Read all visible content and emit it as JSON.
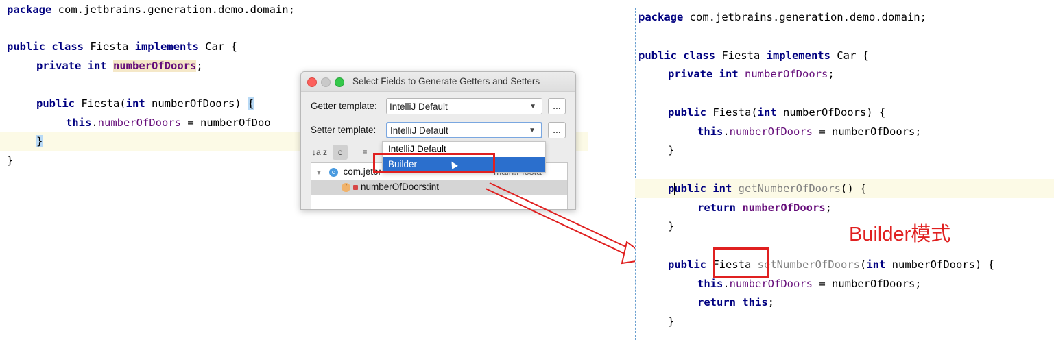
{
  "left_code": {
    "package_kw": "package",
    "package_name": " com.jetbrains.generation.demo.domain;",
    "class_kw1": "public class",
    "class_name": " Fiesta ",
    "class_kw2": "implements",
    "class_rest": " Car {",
    "field_indent": "    ",
    "field_kw": "private int",
    "field_space": " ",
    "field_name": "numberOfDoors",
    "field_end": ";",
    "ctor_kw": "public",
    "ctor_mid": " Fiesta(",
    "ctor_int": "int",
    "ctor_param": " numberOfDoors) ",
    "ctor_brace": "{",
    "this_kw": "this",
    "this_dot": ".",
    "this_field": "numberOfDoors",
    "this_rest": " = numberOfDoo",
    "close_brace_inner": "}",
    "close_brace_outer": "}"
  },
  "dialog": {
    "title": "Select Fields to Generate Getters and Setters",
    "getter_label": "Getter template:",
    "getter_value": "IntelliJ Default",
    "setter_label": "Setter template:",
    "setter_value": "IntelliJ Default",
    "dots": "...",
    "tree_class": "com.jetbr",
    "tree_class_tail": "main.Fiesta",
    "tree_field": "numberOfDoors:int",
    "class_icon": "c",
    "field_icon": "f",
    "sort_icon_label": "↓a z",
    "toolbar_icon2": "c",
    "toolbar_icon3": "≡"
  },
  "dropdown": {
    "options": [
      "IntelliJ Default",
      "Builder"
    ]
  },
  "right_code": {
    "package_kw": "package",
    "package_name": " com.jetbrains.generation.demo.domain;",
    "class_kw1": "public class",
    "class_name": " Fiesta ",
    "class_kw2": "implements",
    "class_rest": " Car {",
    "field_kw": "private int",
    "field_name": "numberOfDoors",
    "field_end": ";",
    "ctor_kw": "public",
    "ctor_mid": " Fiesta(",
    "ctor_int": "int",
    "ctor_param": " numberOfDoors) {",
    "this_kw": "this",
    "this_field": "numberOfDoors",
    "this_rest": " = numberOfDoors;",
    "brace": "}",
    "getter_kw": "ublic int",
    "getter_p": "p",
    "getter_name": " getNumberOfDoors",
    "getter_rest": "() {",
    "return_kw": "return",
    "return_field": "numberOfDoors",
    "return_end": ";",
    "setter_kw": "public",
    "setter_type": "Fiesta",
    "setter_name": " setNumberOfDoors",
    "setter_paren": "(",
    "setter_int": "int",
    "setter_rest": " numberOfDoors) {",
    "return_this": "this",
    "return_this_end": ";"
  },
  "annotation": {
    "text": "Builder模式"
  }
}
